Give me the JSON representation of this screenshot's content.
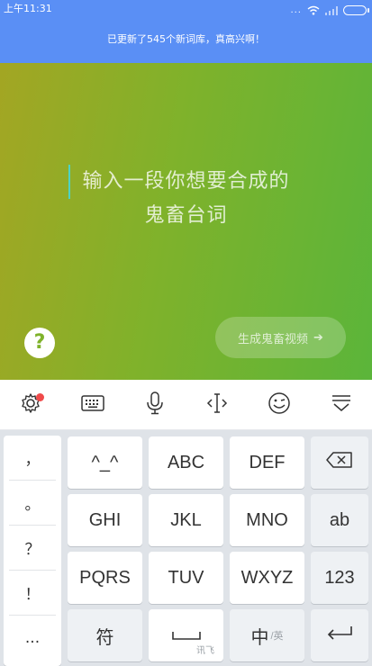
{
  "status": {
    "time": "上午11:31",
    "dots": "...",
    "battery_icon": "battery-icon",
    "wifi_icon": "wifi-icon"
  },
  "notice": "已更新了545个新词库，真高兴啊！",
  "editor": {
    "placeholder_line1": "输入一段你想要合成的",
    "placeholder_line2": "鬼畜台词",
    "help_label": "?",
    "generate_label": "生成鬼畜视频",
    "generate_arrow": "➔"
  },
  "toolbar": {
    "items": [
      "gear-icon",
      "keyboard-icon",
      "microphone-icon",
      "cursor-icon",
      "emoji-icon",
      "collapse-icon"
    ]
  },
  "keyboard": {
    "symbols": [
      "，",
      "。",
      "？",
      "！",
      "..."
    ],
    "keys": {
      "k1": "^_^",
      "k2": "ABC",
      "k3": "DEF",
      "k4": "GHI",
      "k5": "JKL",
      "k6": "MNO",
      "ab": "ab",
      "k7": "PQRS",
      "k8": "TUV",
      "k9": "WXYZ",
      "num": "123",
      "fu": "符",
      "space_brand": "讯飞",
      "zh": "中",
      "zh_sub": "/英"
    }
  },
  "colors": {
    "topbar": "#5a8ff5",
    "accent_green": "#7fb22b",
    "red_dot": "#f04a4a"
  }
}
